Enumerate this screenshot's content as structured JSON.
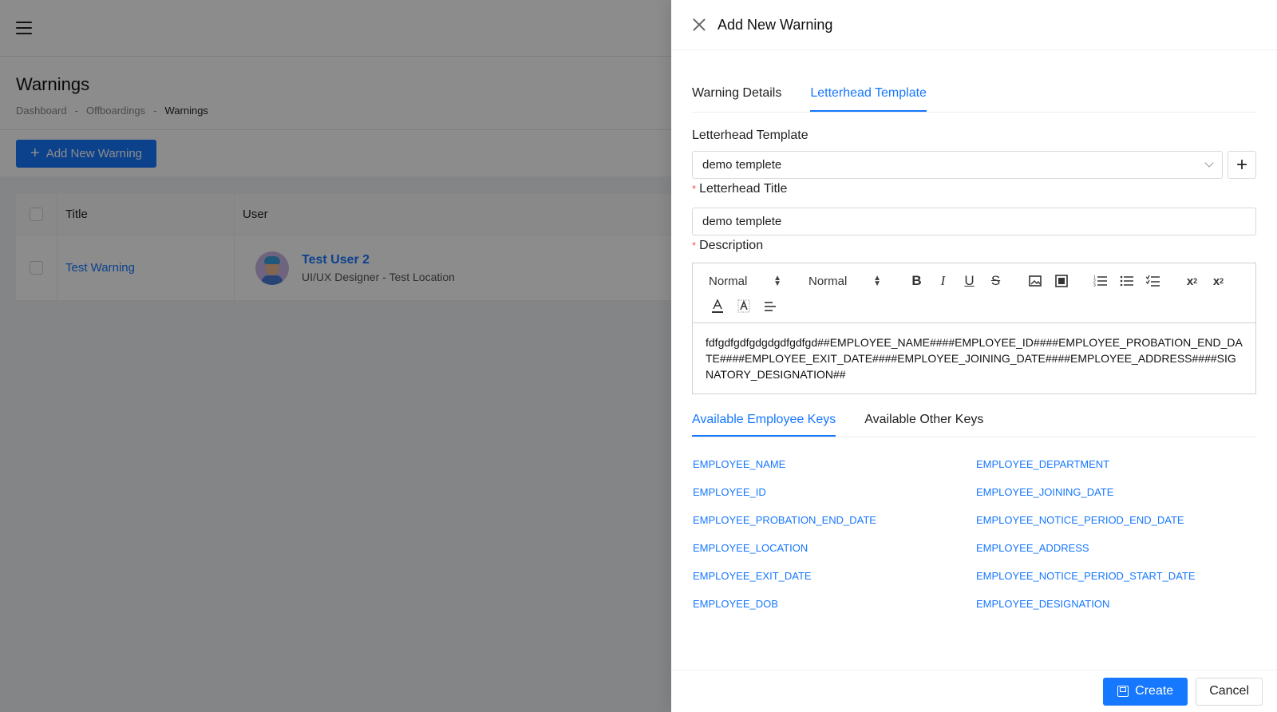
{
  "background": {
    "page_title": "Warnings",
    "breadcrumb": [
      "Dashboard",
      "-",
      "Offboardings",
      "-",
      "Warnings"
    ],
    "add_button_label": "Add New Warning",
    "table": {
      "headers": [
        "Title",
        "User"
      ],
      "rows": [
        {
          "title": "Test Warning",
          "user_name": "Test User 2",
          "user_sub": "UI/UX Designer - Test Location"
        }
      ]
    }
  },
  "drawer": {
    "title": "Add New Warning",
    "tabs": [
      "Warning Details",
      "Letterhead Template"
    ],
    "active_tab": "Letterhead Template",
    "letterhead_template_label": "Letterhead Template",
    "letterhead_template_value": "demo templete",
    "letterhead_title_label": "Letterhead Title",
    "letterhead_title_value": "demo templete",
    "description_label": "Description",
    "editor": {
      "font_select": "Normal",
      "size_select": "Normal",
      "content": "fdfgdfgdfgdgdgdfgdfgd##EMPLOYEE_NAME####EMPLOYEE_ID####EMPLOYEE_PROBATION_END_DATE####EMPLOYEE_EXIT_DATE####EMPLOYEE_JOINING_DATE####EMPLOYEE_ADDRESS####SIGNATORY_DESIGNATION##"
    },
    "key_tabs": [
      "Available Employee Keys",
      "Available Other Keys"
    ],
    "employee_keys": [
      "EMPLOYEE_NAME",
      "EMPLOYEE_DEPARTMENT",
      "EMPLOYEE_ID",
      "EMPLOYEE_JOINING_DATE",
      "EMPLOYEE_PROBATION_END_DATE",
      "EMPLOYEE_NOTICE_PERIOD_END_DATE",
      "EMPLOYEE_LOCATION",
      "EMPLOYEE_ADDRESS",
      "EMPLOYEE_EXIT_DATE",
      "EMPLOYEE_NOTICE_PERIOD_START_DATE",
      "EMPLOYEE_DOB",
      "EMPLOYEE_DESIGNATION"
    ],
    "footer": {
      "create_label": "Create",
      "cancel_label": "Cancel"
    }
  },
  "colors": {
    "primary": "#1677ff",
    "required": "#ff4d4f"
  }
}
